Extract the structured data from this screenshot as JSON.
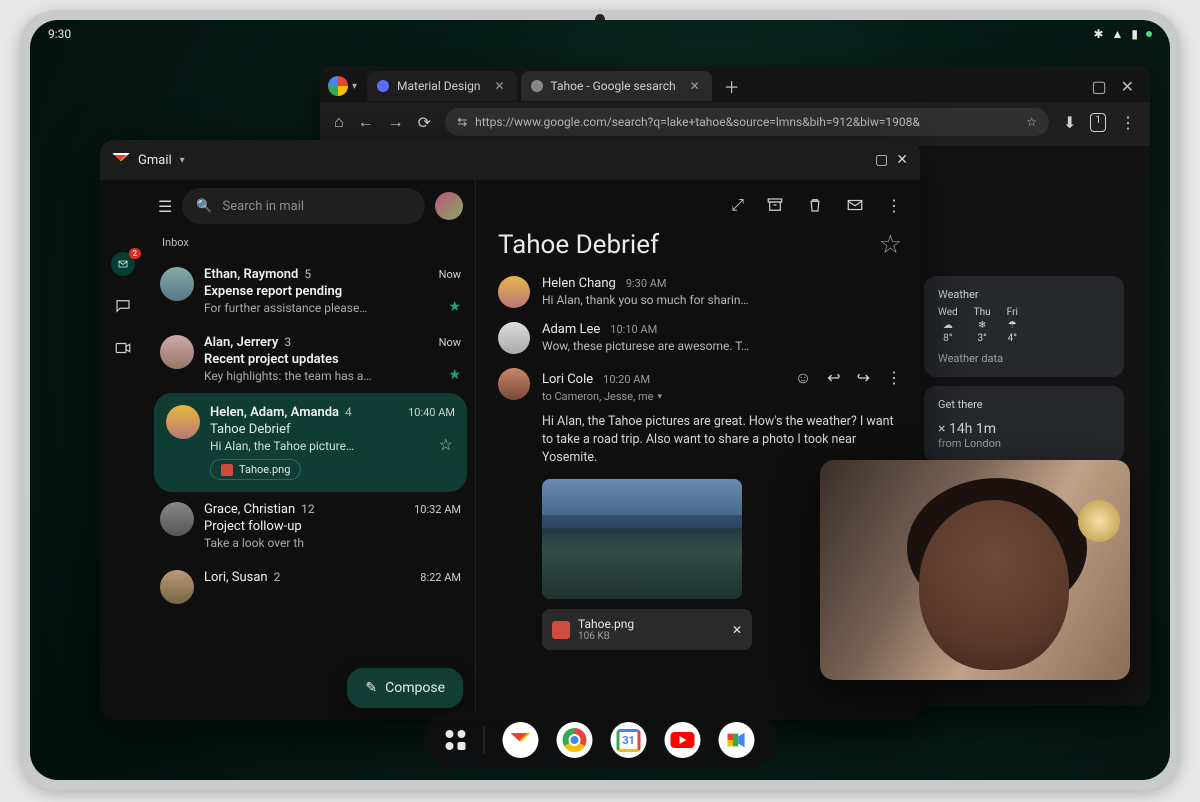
{
  "status": {
    "time": "9:30"
  },
  "chrome": {
    "tabs": [
      {
        "label": "Material Design"
      },
      {
        "label": "Tahoe - Google sesarch"
      }
    ],
    "url": "https://www.google.com/search?q=lake+tahoe&source=lmns&bih=912&biw=1908&",
    "weather": {
      "title": "Weather",
      "days": [
        {
          "d": "Wed",
          "t": "8°"
        },
        {
          "d": "Thu",
          "t": "3°"
        },
        {
          "d": "Fri",
          "t": "4°"
        }
      ],
      "foot": "Weather data"
    },
    "getthere": {
      "title": "Get there",
      "line1": "× 14h 1m",
      "line2": "from London"
    }
  },
  "gmail": {
    "title": "Gmail",
    "search_placeholder": "Search in mail",
    "inbox_label": "Inbox",
    "rail_badge": "2",
    "compose": "Compose",
    "threads": [
      {
        "from": "Ethan, Raymond",
        "count": "5",
        "time": "Now",
        "subject": "Expense report pending",
        "preview": "For further assistance please…",
        "starred": true
      },
      {
        "from": "Alan, Jerrery",
        "count": "3",
        "time": "Now",
        "subject": "Recent project updates",
        "preview": "Key highlights: the team has a…",
        "starred": true
      },
      {
        "from": "Helen, Adam, Amanda",
        "count": "4",
        "time": "10:40 AM",
        "subject": "Tahoe Debrief",
        "preview": "Hi Alan, the Tahoe picture…",
        "attachment": "Tahoe.png",
        "selected": true
      },
      {
        "from": "Grace, Christian",
        "count": "12",
        "time": "10:32 AM",
        "subject": "Project follow-up",
        "preview": "Take a look over th"
      },
      {
        "from": "Lori, Susan",
        "count": "2",
        "time": "8:22 AM",
        "subject": "",
        "preview": ""
      }
    ],
    "open": {
      "subject": "Tahoe Debrief",
      "messages": [
        {
          "from": "Helen Chang",
          "time": "9:30 AM",
          "preview": "Hi Alan, thank you so much for sharin…"
        },
        {
          "from": "Adam Lee",
          "time": "10:10 AM",
          "preview": "Wow, these picturese are awesome. T…"
        },
        {
          "from": "Lori Cole",
          "time": "10:20 AM",
          "to": "to Cameron, Jesse, me",
          "body": "Hi Alan, the Tahoe pictures are great. How's the weather? I want to take a road trip. Also want to share a photo I took near Yosemite."
        }
      ],
      "attachment": {
        "name": "Tahoe.png",
        "size": "106 KB"
      }
    }
  },
  "taskbar": {
    "apps": [
      "gmail",
      "chrome",
      "calendar",
      "youtube",
      "meet"
    ]
  }
}
